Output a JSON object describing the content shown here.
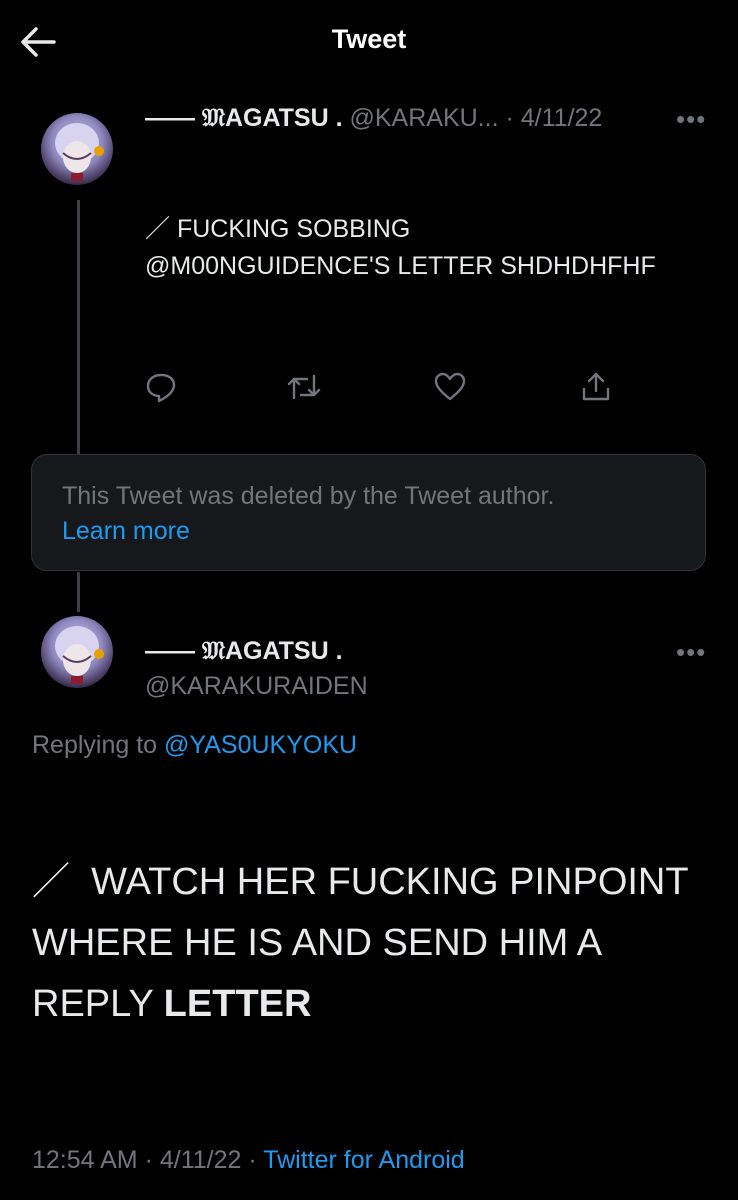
{
  "header": {
    "title": "Tweet"
  },
  "tweet1": {
    "name": "—— 𝔐AGATSU .",
    "handle": "@KARAKU...",
    "separator": "·",
    "date": "4/11/22",
    "more": "•••",
    "text_line1": "／ FUCKING SOBBING",
    "text_line2": "@M00NGUIDENCE'S LETTER SHDHDHFHF"
  },
  "deleted": {
    "message": "This Tweet was deleted by the Tweet author.",
    "learn_more": "Learn more"
  },
  "main_tweet": {
    "name": "—— 𝔐AGATSU .",
    "handle": "@KARAKURAIDEN",
    "more": "•••",
    "replying_prefix": "Replying to",
    "replying_to": "@YAS0UKYOKU",
    "text_slash": "／",
    "text_main": "WATCH HER FUCKING PINPOINT WHERE HE IS AND SEND HIM A REPLY",
    "text_bold": "LETTER",
    "time": "12:54 AM",
    "sep": "·",
    "date": "4/11/22",
    "source": "Twitter for Android"
  },
  "icons": {
    "back": "back-arrow-icon",
    "reply": "reply-icon",
    "retweet": "retweet-icon",
    "like": "like-icon",
    "share": "share-icon"
  }
}
